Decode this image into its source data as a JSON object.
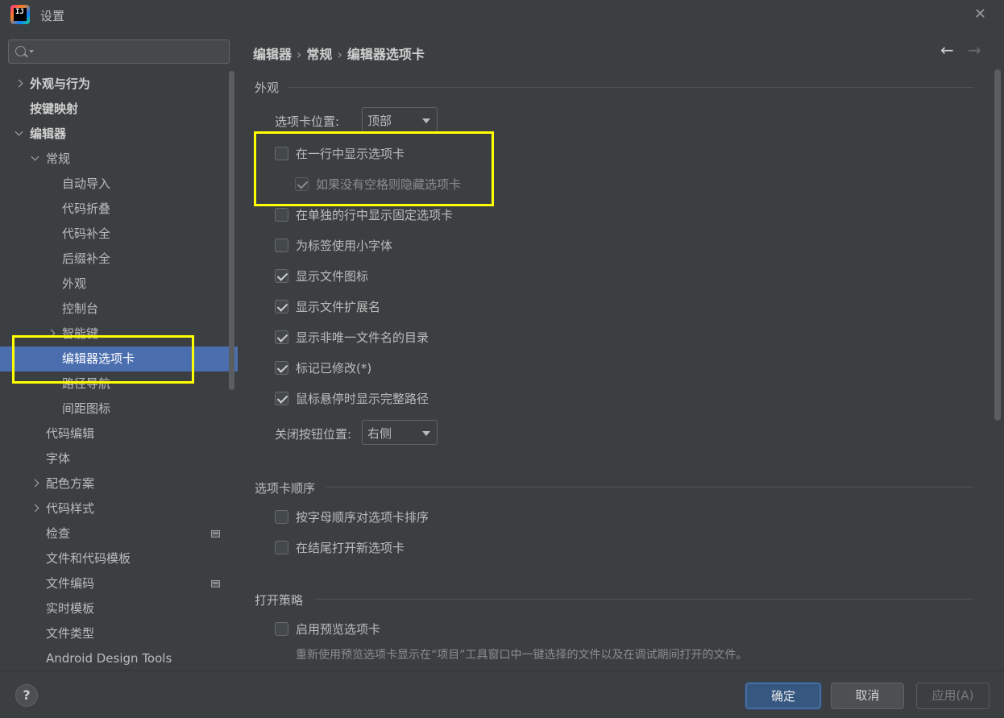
{
  "window": {
    "title": "设置",
    "logo_text": "IJ"
  },
  "search": {
    "placeholder": "",
    "value": ""
  },
  "sidebar": {
    "items": [
      {
        "label": "外观与行为"
      },
      {
        "label": "按键映射"
      },
      {
        "label": "编辑器"
      },
      {
        "label": "常规"
      },
      {
        "label": "自动导入"
      },
      {
        "label": "代码折叠"
      },
      {
        "label": "代码补全"
      },
      {
        "label": "后缀补全"
      },
      {
        "label": "外观"
      },
      {
        "label": "控制台"
      },
      {
        "label": "智能键"
      },
      {
        "label": "编辑器选项卡"
      },
      {
        "label": "路径导航"
      },
      {
        "label": "间距图标"
      },
      {
        "label": "代码编辑"
      },
      {
        "label": "字体"
      },
      {
        "label": "配色方案"
      },
      {
        "label": "代码样式"
      },
      {
        "label": "检查"
      },
      {
        "label": "文件和代码模板"
      },
      {
        "label": "文件编码"
      },
      {
        "label": "实时模板"
      },
      {
        "label": "文件类型"
      },
      {
        "label": "Android Design Tools"
      }
    ],
    "selected": "编辑器选项卡"
  },
  "breadcrumb": {
    "part1": "编辑器",
    "part2": "常规",
    "part3": "编辑器选项卡",
    "separator": "›"
  },
  "nav": {
    "back": "←",
    "forward": "→"
  },
  "appearance": {
    "section_title": "外观",
    "tab_placement_label": "选项卡位置:",
    "tab_placement_value": "顶部",
    "options": [
      {
        "label": "在一行中显示选项卡",
        "checked": false,
        "enabled": true
      },
      {
        "label": "如果没有空格则隐藏选项卡",
        "checked": true,
        "enabled": false
      },
      {
        "label": "在单独的行中显示固定选项卡",
        "checked": false,
        "enabled": true
      },
      {
        "label": "为标签使用小字体",
        "checked": false,
        "enabled": true
      },
      {
        "label": "显示文件图标",
        "checked": true,
        "enabled": true
      },
      {
        "label": "显示文件扩展名",
        "checked": true,
        "enabled": true
      },
      {
        "label": "显示非唯一文件名的目录",
        "checked": true,
        "enabled": true
      },
      {
        "label": "标记已修改(*)",
        "checked": true,
        "enabled": true
      },
      {
        "label": "鼠标悬停时显示完整路径",
        "checked": true,
        "enabled": true
      }
    ],
    "close_button_label": "关闭按钮位置:",
    "close_button_value": "右侧"
  },
  "tab_order": {
    "section_title": "选项卡顺序",
    "options": [
      {
        "label": "按字母顺序对选项卡排序",
        "checked": false
      },
      {
        "label": "在结尾打开新选项卡",
        "checked": false
      }
    ]
  },
  "opening_policy": {
    "section_title": "打开策略",
    "options": [
      {
        "label": "启用预览选项卡",
        "checked": false
      }
    ],
    "hint": "重新使用预览选项卡显示在“项目”工具窗口中一键选择的文件以及在调试期间打开的文件。"
  },
  "footer": {
    "help": "?",
    "ok_label": "确定",
    "cancel_label": "取消",
    "apply_label": "应用(A)"
  },
  "colors": {
    "background": "#3c3f41",
    "selection": "#4b6eaf",
    "highlight_annotation": "#ffff00",
    "primary_button": "#365880"
  }
}
